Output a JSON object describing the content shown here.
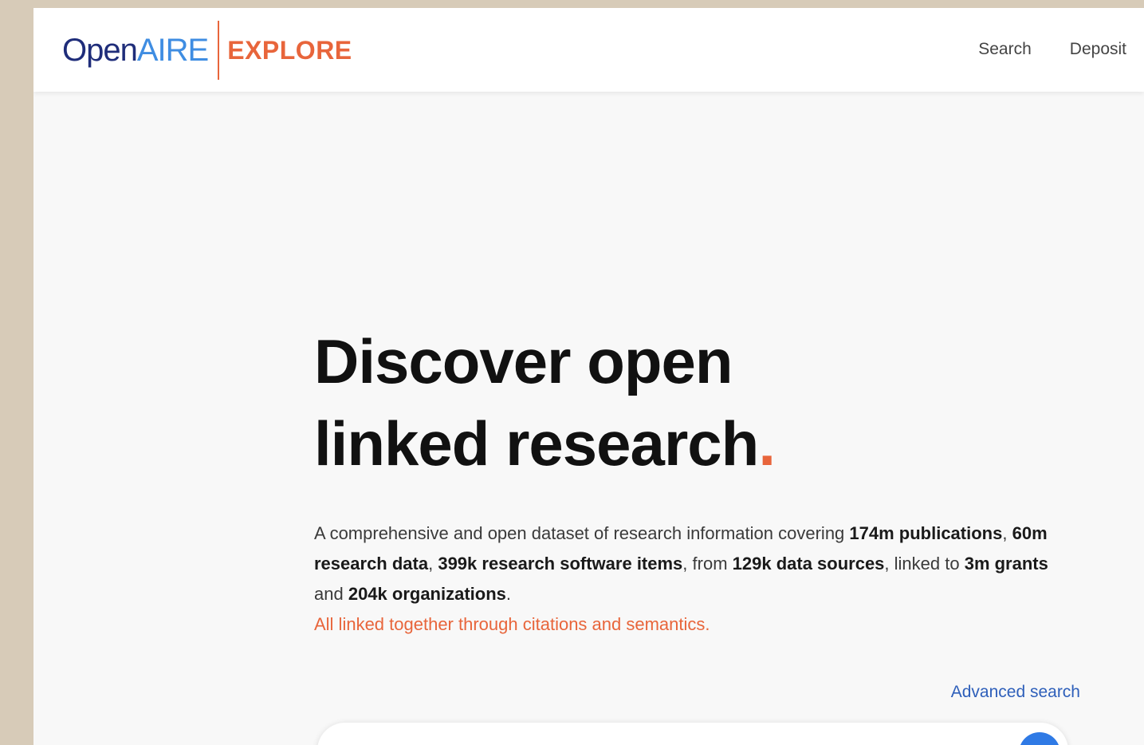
{
  "header": {
    "logo_open": "Open",
    "logo_aire": "AIRE",
    "logo_explore": "EXPLORE",
    "nav": {
      "search": "Search",
      "deposit": "Deposit"
    }
  },
  "hero": {
    "title_line1": "Discover open",
    "title_line2": "linked research",
    "title_dot": ".",
    "desc": {
      "p1": "A comprehensive and open dataset of research information covering ",
      "b1": "174m publications",
      "p2": ", ",
      "b2": "60m research data",
      "p3": ", ",
      "b3": "399k research software items",
      "p4": ", from ",
      "b4": "129k data sources",
      "p5": ", linked to ",
      "b5": "3m grants",
      "p6": " and ",
      "b6": "204k organizations",
      "p7": "."
    },
    "tagline": "All linked together through citations and semantics."
  },
  "search": {
    "advanced_label": "Advanced search",
    "placeholder": ""
  },
  "colors": {
    "brand_dark": "#1f2d7a",
    "brand_blue": "#3f8de2",
    "accent_orange": "#e8653b",
    "link_blue": "#2e5fba",
    "button_blue": "#2f7ae5"
  }
}
